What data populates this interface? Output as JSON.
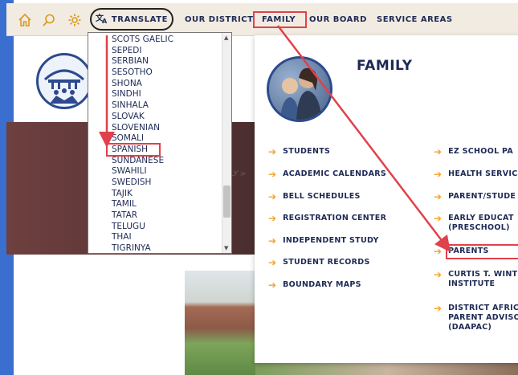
{
  "nav": {
    "icons": [
      "home-icon",
      "search-icon",
      "gear-icon",
      "translate-icon"
    ],
    "translate_label": "TRANSLATE",
    "links": [
      "OUR DISTRICT",
      "FAMILY",
      "OUR BOARD",
      "SERVICE AREAS"
    ],
    "highlight": "FAMILY"
  },
  "translate_dropdown": {
    "languages": [
      "SCOTS GAELIC",
      "SEPEDI",
      "SERBIAN",
      "SESOTHO",
      "SHONA",
      "SINDHI",
      "SINHALA",
      "SLOVAK",
      "SLOVENIAN",
      "SOMALI",
      "SPANISH",
      "SUNDANESE",
      "SWAHILI",
      "SWEDISH",
      "TAJIK",
      "TAMIL",
      "TATAR",
      "TELUGU",
      "THAI",
      "TIGRINYA"
    ],
    "highlight": "SPANISH"
  },
  "breadcrumb_fragment": "MILY >",
  "family_menu": {
    "title": "FAMILY",
    "left_column": [
      "STUDENTS",
      "ACADEMIC CALENDARS",
      "BELL SCHEDULES",
      "REGISTRATION CENTER",
      "INDEPENDENT STUDY",
      "STUDENT RECORDS",
      "BOUNDARY MAPS"
    ],
    "right_column": [
      {
        "lines": [
          "EZ SCHOOL PA"
        ]
      },
      {
        "lines": [
          "HEALTH SERVIC"
        ]
      },
      {
        "lines": [
          "PARENT/STUDE"
        ]
      },
      {
        "lines": [
          "EARLY EDUCAT",
          "(PRESCHOOL)"
        ]
      },
      {
        "lines": [
          "PARENTS"
        ]
      },
      {
        "lines": [
          "CURTIS T. WINT",
          "INSTITUTE"
        ]
      },
      {
        "lines": [
          "DISTRICT AFRIC",
          "PARENT ADVISO",
          "(DAAPAC)"
        ]
      }
    ],
    "highlight": "PARENTS"
  },
  "colors": {
    "nav_bg": "#f1ebe2",
    "navy": "#1e2a55",
    "accent_arrow": "#f2a12a",
    "annotation_red": "#e0414b",
    "side_bar": "#3a6fd0"
  }
}
